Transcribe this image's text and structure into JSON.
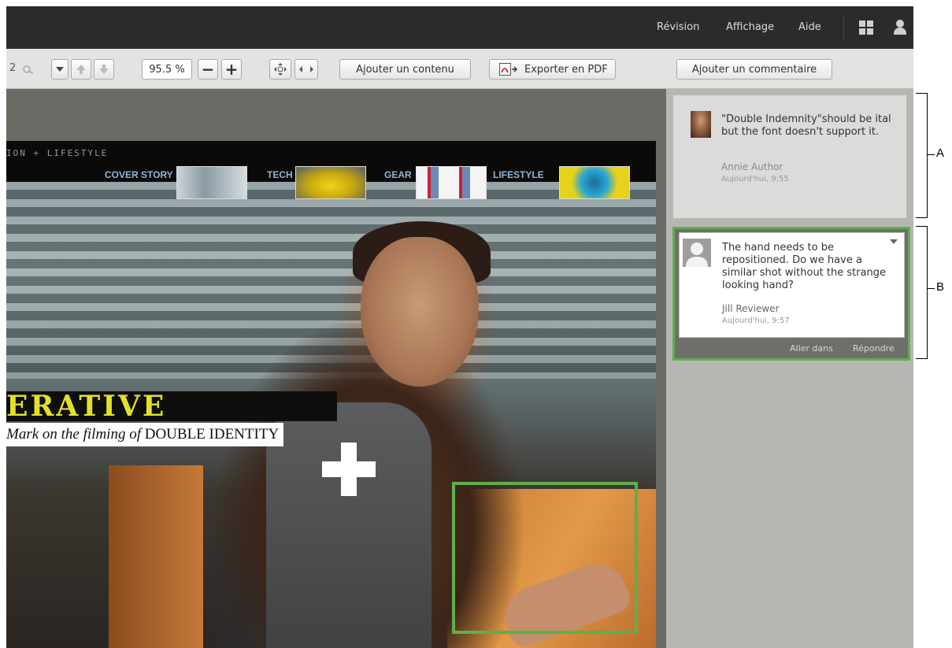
{
  "menu": {
    "revision": "Révision",
    "affichage": "Affichage",
    "aide": "Aide"
  },
  "toolbar": {
    "page_number": "2",
    "zoom_value": "95.5 %",
    "zoom_out": "−",
    "zoom_in": "+",
    "add_content": "Ajouter un contenu",
    "export_pdf": "Exporter en PDF",
    "add_comment": "Ajouter un commentaire"
  },
  "document": {
    "masthead_sub": "ION + LIFESTYLE",
    "nav": [
      "COVER STORY",
      "TECH",
      "GEAR",
      "LIFESTYLE"
    ],
    "headline": "ERATIVE",
    "caption_italic": "Mark on the filming of",
    "caption_caps": "DOUBLE IDENTITY"
  },
  "comments": [
    {
      "text": "\"Double Indemnity\"should be ital but the font doesn't support it.",
      "author": "Annie Author",
      "time": "Aujourd'hui, 9:55"
    },
    {
      "text": "The hand needs to be repositioned. Do we have a similar shot without the strange looking hand?",
      "author": "Jill Reviewer",
      "time": "Aujourd'hui, 9:57",
      "actions": {
        "goto": "Aller dans",
        "reply": "Répondre"
      }
    }
  ],
  "callouts": {
    "a": "A",
    "b": "B"
  },
  "colors": {
    "highlight": "#5fae4d",
    "headline": "#e3e02c"
  }
}
